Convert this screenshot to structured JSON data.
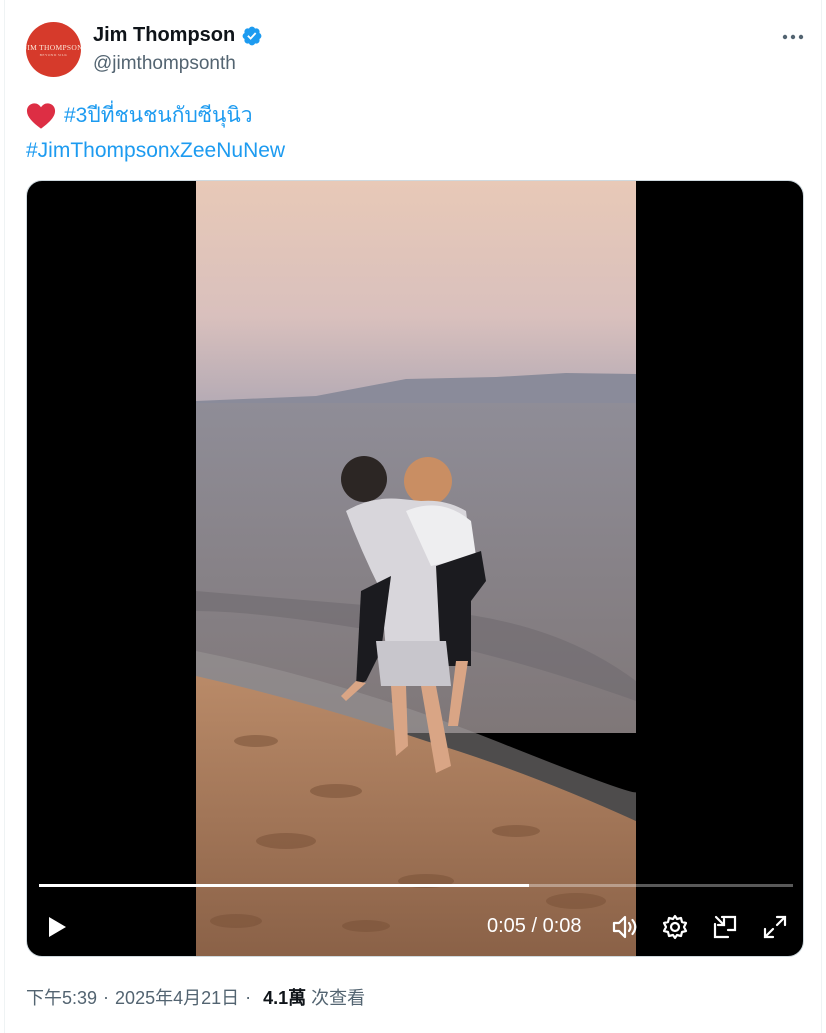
{
  "author": {
    "name": "Jim Thompson",
    "handle": "@jimthompsonth",
    "logo_text": "JIM THOMPSON",
    "logo_subtext": "BEYOND SILK",
    "avatar_color": "#d63a2b",
    "verified": true,
    "verified_color": "#1d9bf0"
  },
  "post": {
    "emoji": "heart",
    "hashtags": [
      "#3ปีที่ชนชนกับซีนุนิว",
      "#JimThompsonxZeeNuNew"
    ],
    "link_color": "#1d9bf0"
  },
  "video": {
    "current_time": "0:05",
    "duration": "0:08",
    "time_display": "0:05 / 0:08",
    "progress_fraction": 0.65,
    "controls": [
      "play-icon",
      "volume-icon",
      "settings-icon",
      "pop-out-icon",
      "fullscreen-icon"
    ]
  },
  "meta": {
    "time": "下午5:39",
    "date": "2025年4月21日",
    "separator": "·",
    "views_count": "4.1萬",
    "views_label": "次查看"
  }
}
